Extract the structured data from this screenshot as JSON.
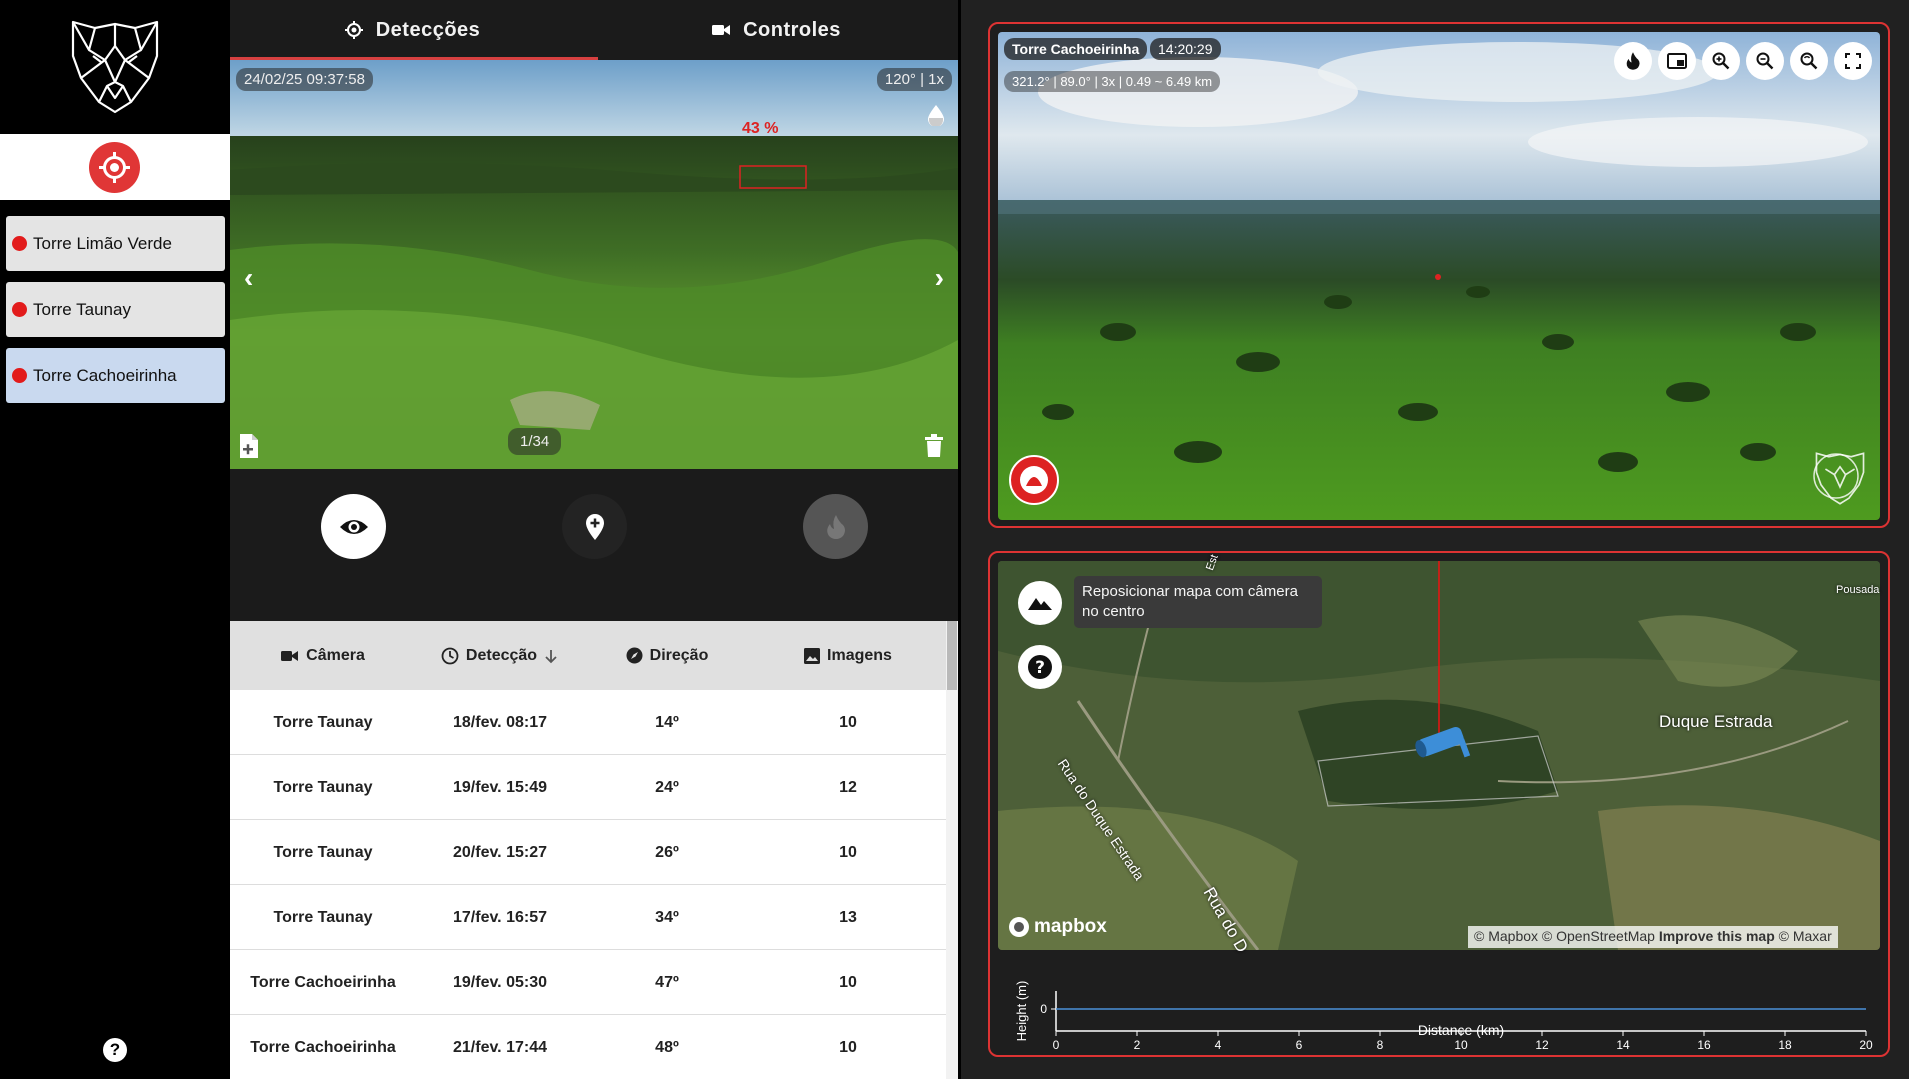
{
  "sidebar": {
    "towers": [
      {
        "label": "Torre Limão Verde",
        "status_color": "#e21b1b",
        "active": false
      },
      {
        "label": "Torre Taunay",
        "status_color": "#e21b1b",
        "active": false
      },
      {
        "label": "Torre Cachoeirinha",
        "status_color": "#e21b1b",
        "active": true
      }
    ],
    "help": "?"
  },
  "tabs": [
    {
      "label": "Detecções",
      "icon": "crosshair-icon",
      "selected": true
    },
    {
      "label": "Controles",
      "icon": "video-camera-icon",
      "selected": false
    }
  ],
  "detection": {
    "timestamp": "24/02/25 09:37:58",
    "fov": "120° | 1x",
    "confidence": "43 %",
    "counter": "1/34"
  },
  "table": {
    "headers": [
      "Câmera",
      "Detecção",
      "Direção",
      "Imagens"
    ],
    "rows": [
      {
        "camera": "Torre Taunay",
        "detection": "18/fev. 08:17",
        "direction": "14º",
        "images": "10"
      },
      {
        "camera": "Torre Taunay",
        "detection": "19/fev. 15:49",
        "direction": "24º",
        "images": "12"
      },
      {
        "camera": "Torre Taunay",
        "detection": "20/fev. 15:27",
        "direction": "26º",
        "images": "10"
      },
      {
        "camera": "Torre Taunay",
        "detection": "17/fev. 16:57",
        "direction": "34º",
        "images": "13"
      },
      {
        "camera": "Torre Cachoeirinha",
        "detection": "19/fev. 05:30",
        "direction": "47º",
        "images": "10"
      },
      {
        "camera": "Torre Cachoeirinha",
        "detection": "21/fev. 17:44",
        "direction": "48º",
        "images": "10"
      }
    ]
  },
  "camera": {
    "name": "Torre Cachoeirinha",
    "time": "14:20:29",
    "info": "321.2° | 89.0° | 3x | 0.49 ~ 6.49 km"
  },
  "map": {
    "tooltip": "Reposicionar mapa com câmera no centro",
    "labels": {
      "duque_estrada": "Duque Estrada",
      "rua_duque": "Rua do Duque Estrada",
      "rua_do_d": "Rua do D",
      "pousada": "Pousada",
      "est": "Est"
    },
    "brand": "mapbox",
    "attribution": {
      "parts": [
        "© Mapbox",
        "© OpenStreetMap"
      ],
      "improve": "Improve this map",
      "maxar": "© Maxar"
    }
  },
  "chart_data": {
    "type": "line",
    "xlabel": "Distance (km)",
    "ylabel": "Height (m)",
    "x_ticks": [
      0,
      2,
      4,
      6,
      8,
      10,
      12,
      14,
      16,
      18,
      20
    ],
    "y_ticks": [
      0
    ],
    "xlim": [
      0,
      20
    ],
    "series": [
      {
        "x": [
          0,
          20
        ],
        "values": [
          0,
          0
        ]
      }
    ],
    "line_color": "#4a90d9"
  }
}
